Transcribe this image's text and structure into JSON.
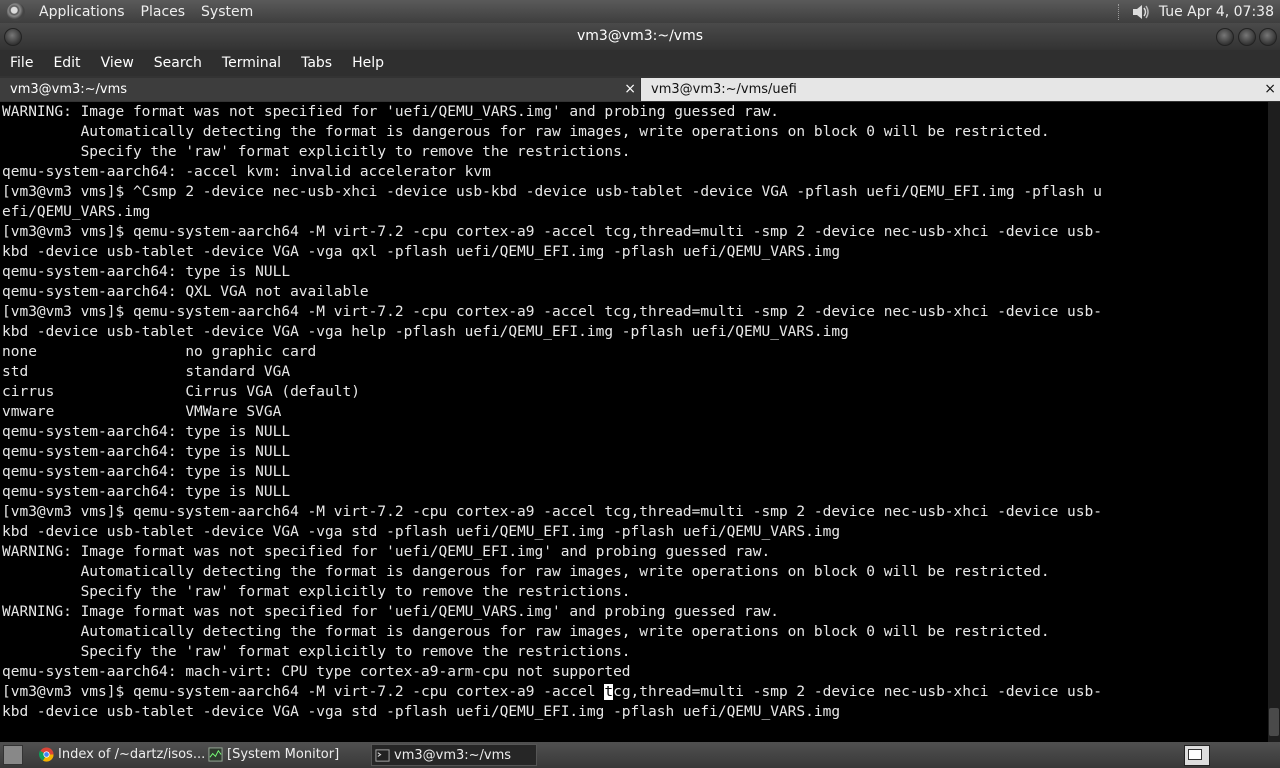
{
  "panel": {
    "menus": [
      "Applications",
      "Places",
      "System"
    ],
    "clock": "Tue Apr  4, 07:38"
  },
  "window": {
    "title": "vm3@vm3:~/vms"
  },
  "menubar": [
    "File",
    "Edit",
    "View",
    "Search",
    "Terminal",
    "Tabs",
    "Help"
  ],
  "tabs": [
    {
      "label": "vm3@vm3:~/vms",
      "close": "×"
    },
    {
      "label": "vm3@vm3:~/vms/uefi",
      "close": "×"
    }
  ],
  "terminal": {
    "lines": [
      "WARNING: Image format was not specified for 'uefi/QEMU_VARS.img' and probing guessed raw.",
      "         Automatically detecting the format is dangerous for raw images, write operations on block 0 will be restricted.",
      "         Specify the 'raw' format explicitly to remove the restrictions.",
      "qemu-system-aarch64: -accel kvm: invalid accelerator kvm",
      "[vm3@vm3 vms]$ ^Csmp 2 -device nec-usb-xhci -device usb-kbd -device usb-tablet -device VGA -pflash uefi/QEMU_EFI.img -pflash u",
      "efi/QEMU_VARS.img",
      "[vm3@vm3 vms]$ qemu-system-aarch64 -M virt-7.2 -cpu cortex-a9 -accel tcg,thread=multi -smp 2 -device nec-usb-xhci -device usb-",
      "kbd -device usb-tablet -device VGA -vga qxl -pflash uefi/QEMU_EFI.img -pflash uefi/QEMU_VARS.img",
      "qemu-system-aarch64: type is NULL",
      "qemu-system-aarch64: QXL VGA not available",
      "[vm3@vm3 vms]$ qemu-system-aarch64 -M virt-7.2 -cpu cortex-a9 -accel tcg,thread=multi -smp 2 -device nec-usb-xhci -device usb-",
      "kbd -device usb-tablet -device VGA -vga help -pflash uefi/QEMU_EFI.img -pflash uefi/QEMU_VARS.img",
      "none                 no graphic card",
      "std                  standard VGA",
      "cirrus               Cirrus VGA (default)",
      "vmware               VMWare SVGA",
      "qemu-system-aarch64: type is NULL",
      "qemu-system-aarch64: type is NULL",
      "qemu-system-aarch64: type is NULL",
      "qemu-system-aarch64: type is NULL",
      "[vm3@vm3 vms]$ qemu-system-aarch64 -M virt-7.2 -cpu cortex-a9 -accel tcg,thread=multi -smp 2 -device nec-usb-xhci -device usb-",
      "kbd -device usb-tablet -device VGA -vga std -pflash uefi/QEMU_EFI.img -pflash uefi/QEMU_VARS.img",
      "WARNING: Image format was not specified for 'uefi/QEMU_EFI.img' and probing guessed raw.",
      "         Automatically detecting the format is dangerous for raw images, write operations on block 0 will be restricted.",
      "         Specify the 'raw' format explicitly to remove the restrictions.",
      "WARNING: Image format was not specified for 'uefi/QEMU_VARS.img' and probing guessed raw.",
      "         Automatically detecting the format is dangerous for raw images, write operations on block 0 will be restricted.",
      "         Specify the 'raw' format explicitly to remove the restrictions.",
      "qemu-system-aarch64: mach-virt: CPU type cortex-a9-arm-cpu not supported"
    ],
    "cursor_line": {
      "before": "[vm3@vm3 vms]$ qemu-system-aarch64 -M virt-7.2 -cpu cortex-a9 -accel ",
      "cursor": "t",
      "after": "cg,thread=multi -smp 2 -device nec-usb-xhci -device usb-"
    },
    "last_line": "kbd -device usb-tablet -device VGA -vga std -pflash uefi/QEMU_EFI.img -pflash uefi/QEMU_VARS.img"
  },
  "taskbar": {
    "tasks": [
      {
        "label": "Index of /~dartz/isos...",
        "icon": "chrome-icon"
      },
      {
        "label": "[System Monitor]",
        "icon": "system-monitor-icon"
      },
      {
        "label": "vm3@vm3:~/vms",
        "icon": "terminal-icon"
      }
    ]
  }
}
